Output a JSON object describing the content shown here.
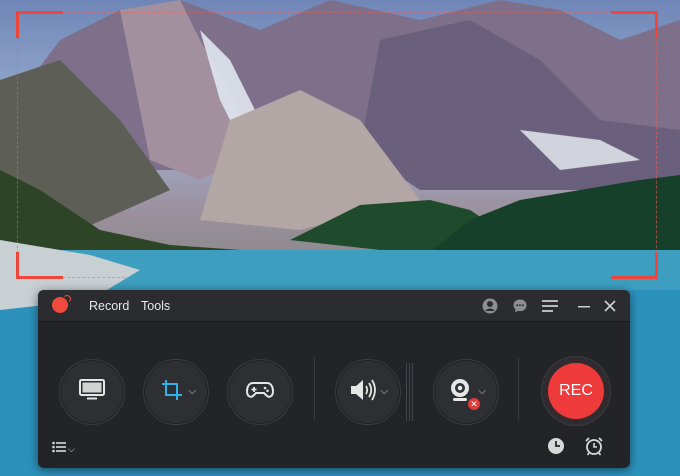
{
  "app": {
    "menu": [
      "Record",
      "Tools"
    ]
  },
  "controls": {
    "record_button_label": "REC"
  },
  "icons": {
    "screen": "monitor-icon",
    "region": "crop-icon",
    "game": "gamepad-icon",
    "audio": "speaker-icon",
    "webcam": "webcam-icon",
    "list": "list-icon",
    "history": "clock-icon",
    "schedule": "alarm-clock-icon"
  },
  "colors": {
    "accent_red": "#ee3a3a",
    "crop_blue": "#2fb3e6",
    "panel_bg": "#232427"
  }
}
